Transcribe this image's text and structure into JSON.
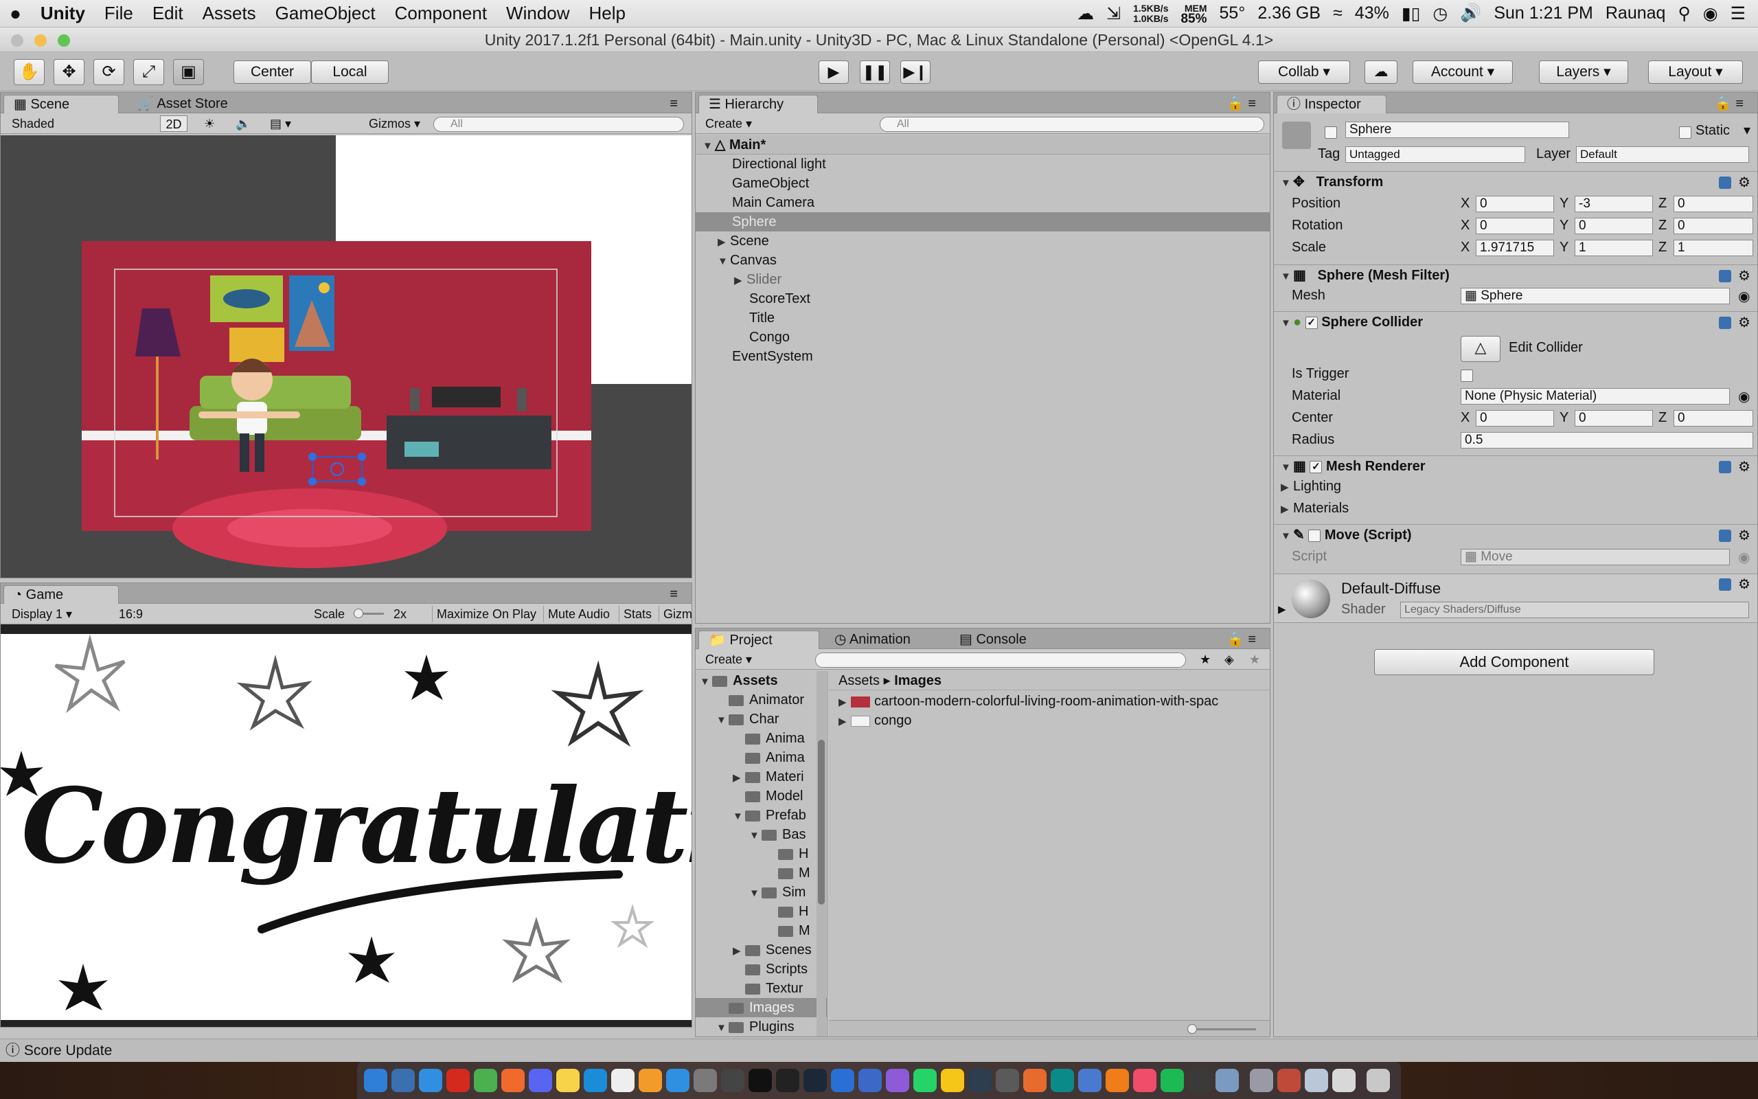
{
  "menubar": {
    "app_name": "Unity",
    "items": [
      "File",
      "Edit",
      "Assets",
      "GameObject",
      "Component",
      "Window",
      "Help"
    ],
    "net_up": "1.5KB/s",
    "net_down": "1.0KB/s",
    "mem_label": "MEM",
    "mem_value": "85%",
    "temp": "55°",
    "memory_free": "2.36 GB",
    "battery": "43%",
    "clock": "Sun 1:21 PM",
    "user": "Raunaq"
  },
  "window_title": "Unity 2017.1.2f1 Personal (64bit) - Main.unity - Unity3D - PC, Mac & Linux Standalone (Personal) <OpenGL 4.1>",
  "toolbar": {
    "pivot_center": "Center",
    "pivot_local": "Local",
    "collab": "Collab ▾",
    "account": "Account",
    "layers": "Layers",
    "layout": "Layout"
  },
  "scene": {
    "tab_scene": "Scene",
    "tab_asset_store": "Asset Store",
    "shading": "Shaded",
    "mode_2d": "2D",
    "gizmos": "Gizmos",
    "search_placeholder": "All"
  },
  "game": {
    "tab": "Game",
    "display": "Display 1",
    "aspect": "16:9",
    "scale_label": "Scale",
    "scale_value": "2x",
    "maximize": "Maximize On Play",
    "mute": "Mute Audio",
    "stats": "Stats",
    "gizmos": "Gizm",
    "congrats_text": "Congratulations!"
  },
  "hierarchy": {
    "tab": "Hierarchy",
    "create": "Create",
    "search_placeholder": "All",
    "scene_name": "Main*",
    "items": [
      {
        "label": "Directional light"
      },
      {
        "label": "GameObject"
      },
      {
        "label": "Main Camera"
      },
      {
        "label": "Sphere"
      },
      {
        "label": "Scene"
      },
      {
        "label": "Canvas"
      },
      {
        "label": "Slider"
      },
      {
        "label": "ScoreText"
      },
      {
        "label": "Title"
      },
      {
        "label": "Congo"
      },
      {
        "label": "EventSystem"
      }
    ]
  },
  "project": {
    "tab_project": "Project",
    "tab_animation": "Animation",
    "tab_console": "Console",
    "create": "Create",
    "tree": [
      "Assets",
      "Animator",
      "Char",
      "Anima",
      "Anima",
      "Materi",
      "Model",
      "Prefab",
      "Bas",
      "H",
      "M",
      "Sim",
      "H",
      "M",
      "Scenes",
      "Scripts",
      "Textur",
      "Images",
      "Plugins"
    ],
    "breadcrumb_root": "Assets",
    "breadcrumb_current": "Images",
    "files": [
      {
        "label": "cartoon-modern-colorful-living-room-animation-with-spac"
      },
      {
        "label": "congo"
      }
    ]
  },
  "inspector": {
    "tab": "Inspector",
    "object_name": "Sphere",
    "static_label": "Static",
    "tag_label": "Tag",
    "tag_value": "Untagged",
    "layer_label": "Layer",
    "layer_value": "Default",
    "transform": {
      "title": "Transform",
      "position_label": "Position",
      "rotation_label": "Rotation",
      "scale_label": "Scale",
      "position": {
        "x": "0",
        "y": "-3",
        "z": "0"
      },
      "rotation": {
        "x": "0",
        "y": "0",
        "z": "0"
      },
      "scale": {
        "x": "1.971715",
        "y": "1",
        "z": "1"
      }
    },
    "mesh_filter": {
      "title": "Sphere (Mesh Filter)",
      "mesh_label": "Mesh",
      "mesh_value": "Sphere"
    },
    "sphere_collider": {
      "title": "Sphere Collider",
      "edit_collider": "Edit Collider",
      "is_trigger_label": "Is Trigger",
      "material_label": "Material",
      "material_value": "None (Physic Material)",
      "center_label": "Center",
      "center": {
        "x": "0",
        "y": "0",
        "z": "0"
      },
      "radius_label": "Radius",
      "radius_value": "0.5"
    },
    "mesh_renderer": {
      "title": "Mesh Renderer",
      "lighting": "Lighting",
      "materials": "Materials"
    },
    "move_script": {
      "title": "Move (Script)",
      "script_label": "Script",
      "script_value": "Move"
    },
    "material": {
      "name": "Default-Diffuse",
      "shader_label": "Shader",
      "shader_value": "Legacy Shaders/Diffuse"
    },
    "add_component": "Add Component"
  },
  "status": {
    "message": "Score Update"
  }
}
